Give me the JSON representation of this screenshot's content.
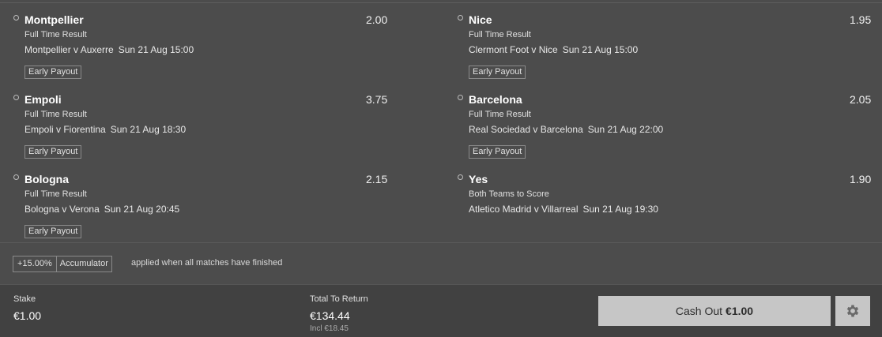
{
  "selections": [
    {
      "name": "Montpellier",
      "odds": "2.00",
      "market": "Full Time Result",
      "event": "Montpellier v Auxerre",
      "time": "Sun 21 Aug 15:00",
      "badge": "Early Payout"
    },
    {
      "name": "Nice",
      "odds": "1.95",
      "market": "Full Time Result",
      "event": "Clermont Foot v Nice",
      "time": "Sun 21 Aug 15:00",
      "badge": "Early Payout"
    },
    {
      "name": "Empoli",
      "odds": "3.75",
      "market": "Full Time Result",
      "event": "Empoli v Fiorentina",
      "time": "Sun 21 Aug 18:30",
      "badge": "Early Payout"
    },
    {
      "name": "Barcelona",
      "odds": "2.05",
      "market": "Full Time Result",
      "event": "Real Sociedad v Barcelona",
      "time": "Sun 21 Aug 22:00",
      "badge": "Early Payout"
    },
    {
      "name": "Bologna",
      "odds": "2.15",
      "market": "Full Time Result",
      "event": "Bologna v Verona",
      "time": "Sun 21 Aug 20:45",
      "badge": "Early Payout"
    },
    {
      "name": "Yes",
      "odds": "1.90",
      "market": "Both Teams to Score",
      "event": "Atletico Madrid v Villarreal",
      "time": "Sun 21 Aug 19:30",
      "badge": ""
    }
  ],
  "bonus": {
    "percent": "+15.00%",
    "label": "Accumulator",
    "note": "applied when all matches have finished"
  },
  "footer": {
    "stake_label": "Stake",
    "stake_value": "€1.00",
    "return_label": "Total To Return",
    "return_value": "€134.44",
    "return_incl": "Incl €18.45",
    "cashout_label": "Cash Out",
    "cashout_value": "€1.00",
    "settings_icon": "gear-icon"
  }
}
